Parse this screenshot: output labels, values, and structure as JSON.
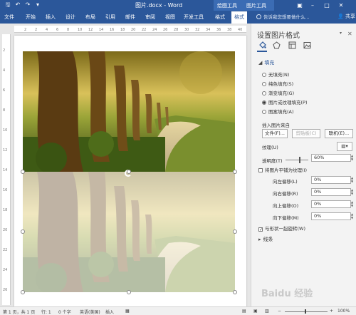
{
  "window": {
    "title": "图片.docx - Word",
    "context_group": "图片工具",
    "context_labels": [
      "绘图工具",
      "图片工具"
    ],
    "min_icon": "minimize-icon",
    "restore_icon": "restore-icon",
    "close_icon": "close-icon"
  },
  "quick_access": {
    "save_icon": "save-icon",
    "undo_icon": "undo-icon",
    "redo_icon": "redo-icon",
    "customize_icon": "customize-icon"
  },
  "tabs": [
    "文件",
    "开始",
    "插入",
    "设计",
    "布局",
    "引用",
    "邮件",
    "审阅",
    "视图",
    "开发工具",
    "格式",
    "格式"
  ],
  "active_tab": "格式",
  "tellme": "告诉我您想要做什么...",
  "share": "共享",
  "ruler": {
    "h_ticks": [
      "2",
      "2",
      "4",
      "6",
      "8",
      "10",
      "12",
      "14",
      "16",
      "18",
      "20",
      "22",
      "24",
      "26",
      "28",
      "30",
      "32",
      "34",
      "36",
      "38",
      "40"
    ],
    "v_ticks": [
      "2",
      "4",
      "6",
      "8",
      "10",
      "12",
      "14",
      "16",
      "18",
      "20",
      "22",
      "24",
      "26"
    ]
  },
  "pane": {
    "title": "设置图片格式",
    "tabs_icons": [
      "fill-line-icon",
      "effects-icon",
      "layout-properties-icon",
      "picture-icon"
    ],
    "section_fill": "填充",
    "fill_options": [
      "无填充(N)",
      "纯色填充(S)",
      "渐变填充(G)",
      "图片或纹理填充(P)",
      "图案填充(A)"
    ],
    "fill_selected": "图片或纹理填充(P)",
    "insert_from": "插入图片来自",
    "btn_file": "文件(F)...",
    "btn_clipboard": "剪贴板(C)",
    "btn_online": "联机(E)...",
    "texture_label": "纹理(U)",
    "transparency_label": "透明度(T)",
    "transparency_value": "60%",
    "transparency_level": 0.6,
    "tile_label": "将图片平铺为纹理(I)",
    "tile_checked": false,
    "offset_left_label": "向左偏移(L)",
    "offset_left_value": "0%",
    "offset_right_label": "向右偏移(R)",
    "offset_right_value": "0%",
    "offset_top_label": "向上偏移(O)",
    "offset_top_value": "0%",
    "offset_bottom_label": "向下偏移(M)",
    "offset_bottom_value": "0%",
    "rotate_label": "与形状一起旋转(W)",
    "rotate_checked": true,
    "section_line": "线条"
  },
  "status": {
    "page": "第 1 页，共 1 页",
    "line": "行: 1",
    "words": "0 个字",
    "lang": "英语(美国)",
    "mode": "插入",
    "zoom": "100%"
  },
  "watermark": "Baidu 经验"
}
